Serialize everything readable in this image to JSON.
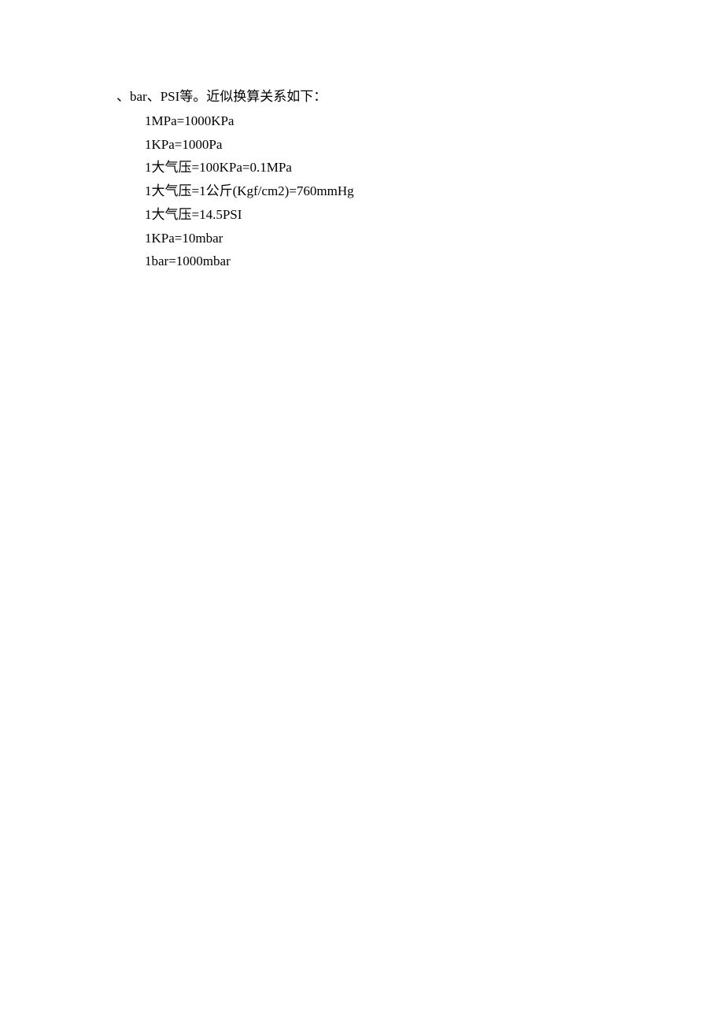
{
  "lines": {
    "header": "、bar、PSI等。近似换算关系如下：",
    "l1": "1MPa=1000KPa",
    "l2": "1KPa=1000Pa",
    "l3": "1大气压=100KPa=0.1MPa",
    "l4": "1大气压=1公斤(Kgf/cm2)=760mmHg",
    "l5": "1大气压=14.5PSI",
    "l6": "1KPa=10mbar",
    "l7": "1bar=1000mbar"
  }
}
